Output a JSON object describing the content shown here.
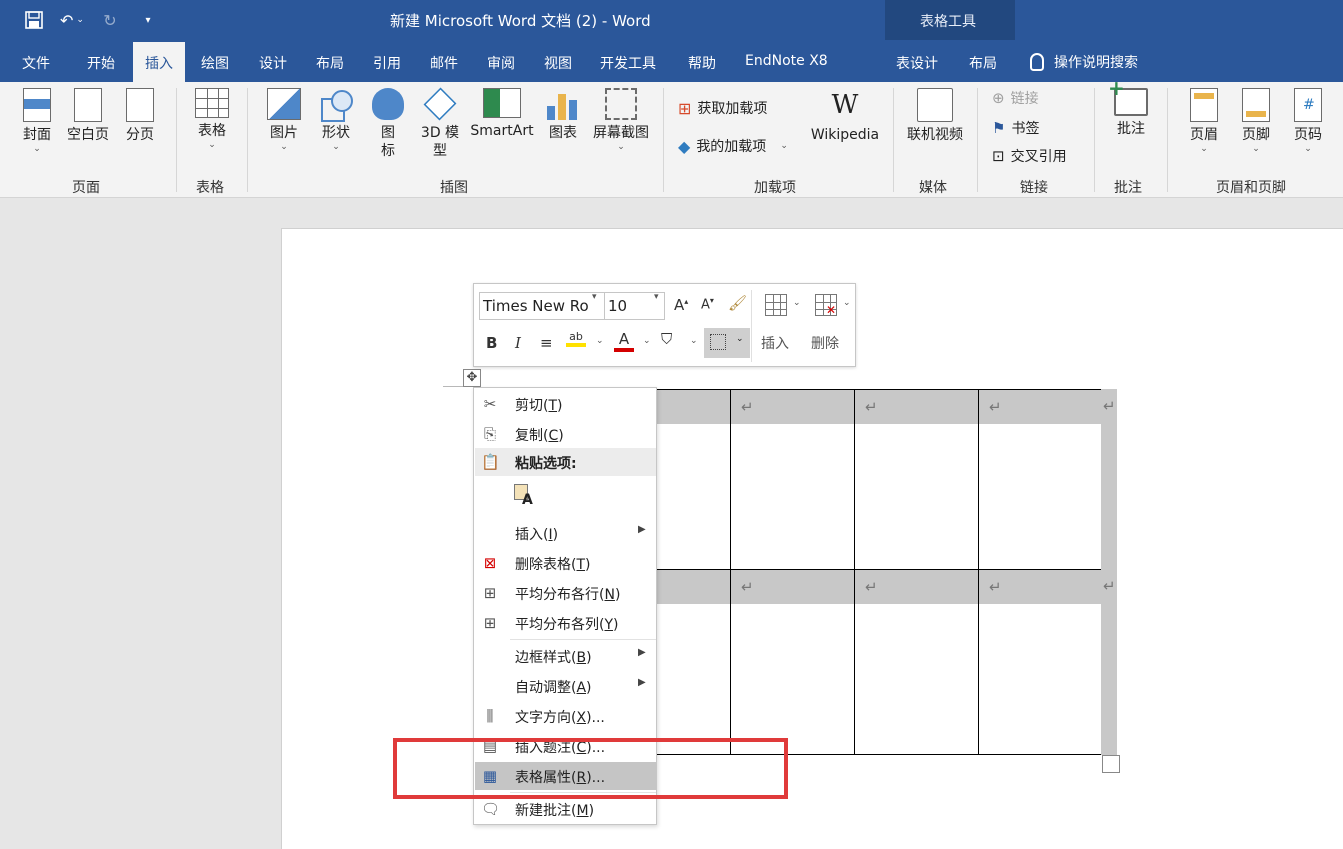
{
  "window": {
    "title": "新建 Microsoft Word 文档 (2)  -  Word",
    "context_tab_group": "表格工具"
  },
  "tabs": [
    "文件",
    "开始",
    "插入",
    "绘图",
    "设计",
    "布局",
    "引用",
    "邮件",
    "审阅",
    "视图",
    "开发工具",
    "帮助",
    "EndNote X8",
    "表设计",
    "布局"
  ],
  "active_tab": "插入",
  "search_tab": "操作说明搜索",
  "ribbon": {
    "pages": {
      "label": "页面",
      "cover": "封面",
      "blank": "空白页",
      "break": "分页"
    },
    "tables": {
      "label": "表格",
      "table": "表格"
    },
    "illustrations": {
      "label": "插图",
      "picture": "图片",
      "shapes": "形状",
      "icons_1": "图",
      "icons_2": "标",
      "model_1": "3D 模",
      "model_2": "型",
      "smartart": "SmartArt",
      "chart": "图表",
      "screenshot": "屏幕截图"
    },
    "addins": {
      "label": "加载项",
      "get": "获取加载项",
      "my": "我的加载项",
      "wikipedia": "Wikipedia"
    },
    "media": {
      "label": "媒体",
      "video": "联机视频"
    },
    "links": {
      "label": "链接",
      "link": "链接",
      "bookmark": "书签",
      "crossref": "交叉引用"
    },
    "comments": {
      "label": "批注",
      "comment": "批注"
    },
    "header_footer": {
      "label": "页眉和页脚",
      "header": "页眉",
      "footer": "页脚",
      "page_number": "页码"
    }
  },
  "mini_toolbar": {
    "font": "Times New Ro",
    "size": "10",
    "grow": "A",
    "shrink": "A",
    "bold": "B",
    "italic": "I",
    "insert": "插入",
    "delete": "删除"
  },
  "context_menu": {
    "cut": {
      "label": "剪切(",
      "key": "T",
      "end": ")"
    },
    "copy": {
      "label": "复制(",
      "key": "C",
      "end": ")"
    },
    "paste_options": "粘贴选项:",
    "insert": {
      "label": "插入(",
      "key": "I",
      "end": ")"
    },
    "delete_table": {
      "label": "删除表格(",
      "key": "T",
      "end": ")"
    },
    "distribute_rows": {
      "label": "平均分布各行(",
      "key": "N",
      "end": ")"
    },
    "distribute_cols": {
      "label": "平均分布各列(",
      "key": "Y",
      "end": ")"
    },
    "border_styles": {
      "label": "边框样式(",
      "key": "B",
      "end": ")"
    },
    "autofit": {
      "label": "自动调整(",
      "key": "A",
      "end": ")"
    },
    "text_direction": {
      "label": "文字方向(",
      "key": "X",
      "end": ")..."
    },
    "insert_caption": {
      "label": "插入题注(",
      "key": "C",
      "end": ")..."
    },
    "table_properties": {
      "label": "表格属性(",
      "key": "R",
      "end": ")..."
    },
    "new_comment": {
      "label": "新建批注(",
      "key": "M",
      "end": ")"
    }
  },
  "table": {
    "paragraph_mark": "↵"
  },
  "colors": {
    "brand": "#2b579a",
    "highlight_box": "#e03a3a",
    "font_color": "#d40000",
    "highlighter": "#ffe100"
  }
}
